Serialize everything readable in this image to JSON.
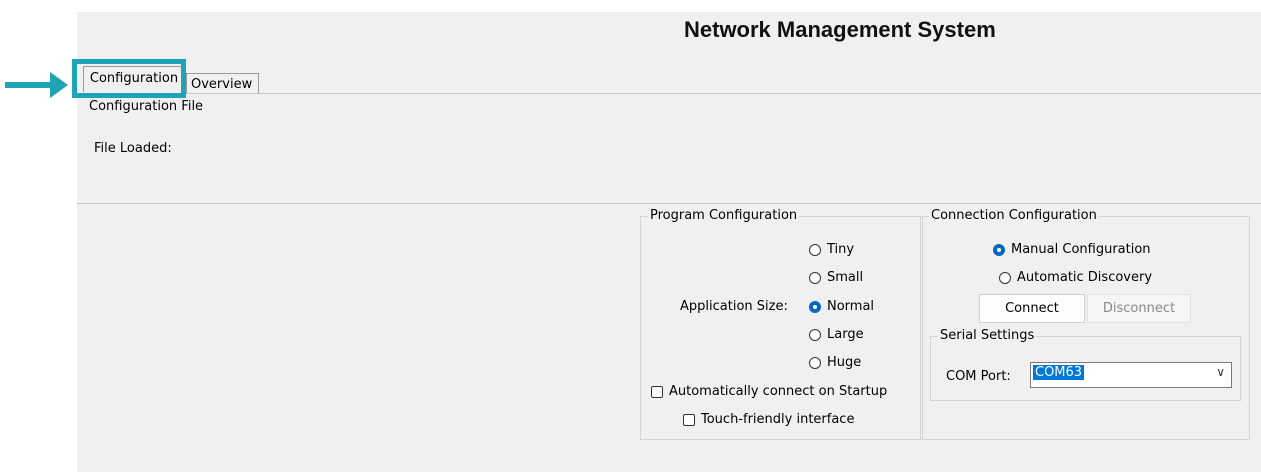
{
  "window": {
    "title": "Network Management System"
  },
  "tabs": [
    {
      "label": "Configuration",
      "selected": true
    },
    {
      "label": "Overview",
      "selected": false
    }
  ],
  "config_file": {
    "legend": "Configuration File",
    "file_loaded_label": "File Loaded:"
  },
  "program_config": {
    "legend": "Program Configuration",
    "app_size_label": "Application Size:",
    "sizes": [
      {
        "label": "Tiny",
        "selected": false
      },
      {
        "label": "Small",
        "selected": false
      },
      {
        "label": "Normal",
        "selected": true
      },
      {
        "label": "Large",
        "selected": false
      },
      {
        "label": "Huge",
        "selected": false
      }
    ],
    "auto_connect_label": "Automatically connect on Startup",
    "touch_friendly_label": "Touch-friendly interface"
  },
  "connection_config": {
    "legend": "Connection Configuration",
    "manual_label": "Manual Configuration",
    "automatic_label": "Automatic Discovery",
    "connect_label": "Connect",
    "disconnect_label": "Disconnect",
    "serial": {
      "legend": "Serial Settings",
      "com_port_label": "COM Port:",
      "com_port_value": "COM63"
    }
  },
  "colors": {
    "highlight": "#1ea4b4",
    "selected_radio": "#0067c0",
    "selection": "#0078d7"
  }
}
